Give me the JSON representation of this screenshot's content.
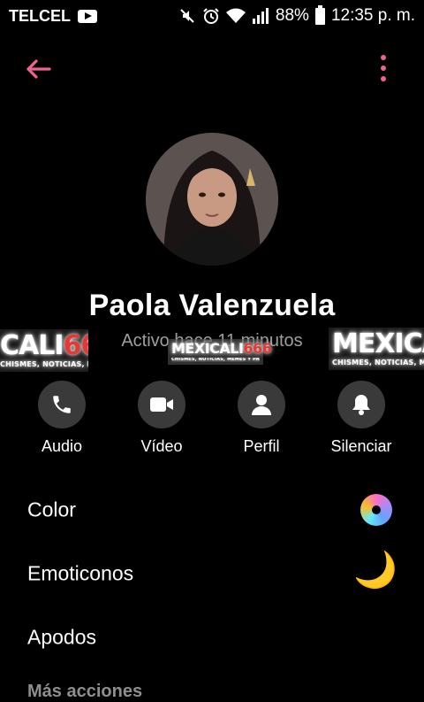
{
  "status_bar": {
    "carrier": "TELCEL",
    "battery": "88%",
    "time": "12:35 p. m."
  },
  "profile": {
    "name": "Paola Valenzuela",
    "active_status": "Activo hace 11 minutos"
  },
  "watermark": {
    "brand_left": "CALI",
    "brand_num": "666",
    "brand_full": "MEXICALI",
    "tagline": "CHISMES, NOTICIAS, MEMES Y PACKS"
  },
  "actions": [
    {
      "label": "Audio",
      "icon": "phone-icon"
    },
    {
      "label": "Vídeo",
      "icon": "video-camera-icon"
    },
    {
      "label": "Perfil",
      "icon": "person-icon"
    },
    {
      "label": "Silenciar",
      "icon": "bell-icon"
    }
  ],
  "menu": {
    "color_label": "Color",
    "emoji_label": "Emoticonos",
    "emoji_value": "🌙",
    "nickname_label": "Apodos",
    "more_actions_header": "Más acciones"
  },
  "colors": {
    "accent": "#f06292",
    "action_circle": "#3a3a3a",
    "secondary_text": "#9e9e9e"
  }
}
